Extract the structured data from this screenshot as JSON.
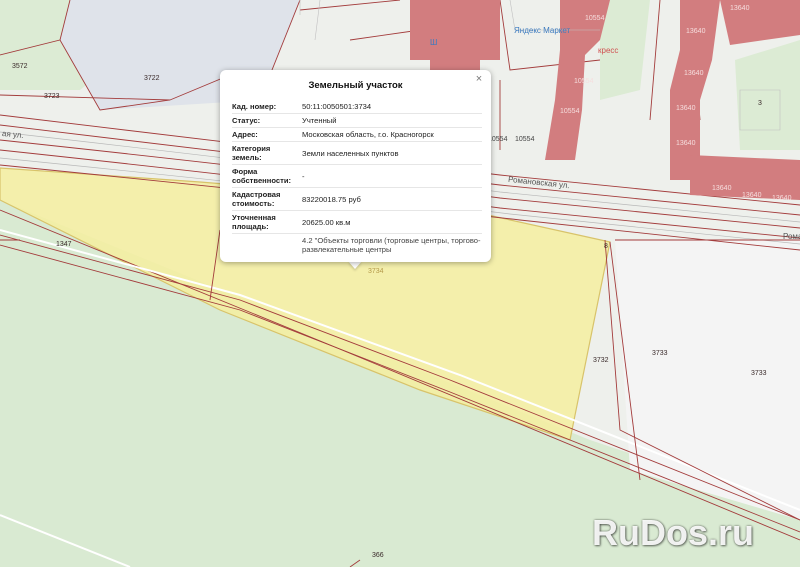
{
  "map": {
    "colors": {
      "background": "#eef0ec",
      "green_zone": "#d9ead2",
      "plot_highlight": "#f4eea0",
      "parcel_line": "#a33c3c",
      "building": "#d27d7f"
    },
    "parcel_labels": [
      "3572",
      "3722",
      "3723",
      "1347",
      "3734",
      "3732",
      "3733",
      "3733",
      "366"
    ],
    "building_labels": [
      "10554",
      "10554",
      "10554",
      "10554",
      "10554",
      "13640",
      "13640",
      "13640",
      "13640",
      "13640",
      "13640",
      "13640",
      "13640"
    ],
    "street_labels": [
      "Романовская ул.",
      "Романовская ул.",
      "ая ул.",
      "Роман"
    ],
    "poi_labels": [
      "Яндекс Маркет",
      "кресс",
      "Ш"
    ],
    "misc_labels": [
      "8",
      "3"
    ]
  },
  "popup": {
    "title": "Земельный участок",
    "close_symbol": "×",
    "rows": [
      {
        "key": "Кад. номер:",
        "value": "50:11:0050501:3734"
      },
      {
        "key": "Статус:",
        "value": "Учтенный"
      },
      {
        "key": "Адрес:",
        "value": "Московская область, г.о. Красногорск"
      },
      {
        "key": "Категория земель:",
        "value": "Земли населенных пунктов"
      },
      {
        "key": "Форма собственности:",
        "value": "-"
      },
      {
        "key": "Кадастровая стоимость:",
        "value": "83220018.75 руб"
      },
      {
        "key": "Уточненная площадь:",
        "value": "20625.00 кв.м"
      },
      {
        "key": "",
        "value": "4.2 \"Объекты торговли (торговые центры, торгово-развлекательные центры"
      }
    ]
  },
  "watermark": {
    "brand": "RuDos",
    "dot": ".",
    "tld": "ru"
  }
}
